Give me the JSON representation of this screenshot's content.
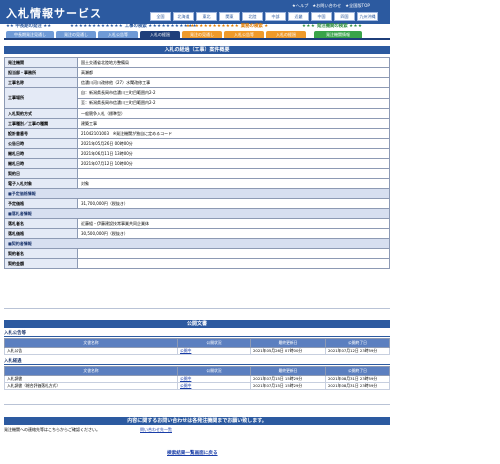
{
  "header": {
    "logo": "入札情報サービス",
    "top_links": [
      "★ヘルプ",
      "★お問い合わせ",
      "★全国版TOP"
    ],
    "regions": [
      "全国",
      "北海道",
      "東北",
      "関東",
      "北陸",
      "中部",
      "近畿",
      "中国",
      "四国",
      "九州沖縄"
    ],
    "sections": [
      {
        "stars_left": "★★★★★★★★★★★★",
        "label": "工事の検索",
        "stars_right": "★★★★★★★★★★★"
      },
      {
        "stars_left": "★★★★★★★★★★★★",
        "label": "業務の検索",
        "stars_right": "★"
      },
      {
        "stars_left": "★★★",
        "label": "発注機関の検索",
        "stars_right": "★★★"
      }
    ],
    "left_section_prefix": "★★ 中長期の発注 ★★",
    "tabs": [
      "中長期発注見通し",
      "発注の見通し",
      "入札公告等",
      "入札の経過",
      "発注の見通し",
      "入札公告等",
      "入札の経過",
      "発注機関情報"
    ]
  },
  "detail": {
    "title": "入札の経過（工事）案件概要",
    "rows": [
      {
        "k": "発注機関",
        "v": "国土交通省北陸地方整備局"
      },
      {
        "k": "担当部・事務所",
        "v": "高瀬都"
      },
      {
        "k": "工事名称",
        "v": "信濃川河川改修他（27）水閘改修工事"
      },
      {
        "k": "工事場所",
        "v": "自：新潟県長岡市信濃川三町目範囲内2-2"
      },
      {
        "k": "",
        "v": "至：新潟県長岡市信濃川三町目範囲内2-2"
      },
      {
        "k": "入札契約方式",
        "v": "一般競争入札（標準型）"
      },
      {
        "k": "工事種別／工事の種類",
        "v": "建築工事"
      },
      {
        "k": "設計書番号",
        "v": "21042101003",
        "note": "※発注機関が独自に定めるコード"
      },
      {
        "k": "公告日時",
        "v": "2021年05月26日 00時00分"
      },
      {
        "k": "開札日時",
        "v": "2021年06月11日 13時00分"
      },
      {
        "k": "開札日時",
        "v": "2021年07月12日 10時00分"
      },
      {
        "k": "契約日",
        "v": ""
      },
      {
        "k": "電子入札対象",
        "v": "対象"
      },
      {
        "full": "■予定価格情報"
      },
      {
        "k": "予定価格",
        "v": "31,700,000円（税抜き）"
      },
      {
        "full": "■落札者情報"
      },
      {
        "k": "落札者名",
        "v": "近藤組・伊藤建設技常事業共同企業体"
      },
      {
        "k": "落札価格",
        "v": "30,500,000円（税抜き）"
      },
      {
        "full": "■契約者情報"
      },
      {
        "k": "契約者名",
        "v": ""
      },
      {
        "k": "契約金額",
        "v": ""
      }
    ]
  },
  "documents": {
    "title": "公開文書",
    "groups": [
      {
        "label": "入札公告等",
        "columns": [
          "文書名称",
          "公開状況",
          "最終更新日",
          "公開終了日"
        ],
        "rows": [
          [
            "入札公告",
            "公開中",
            "2021年05月26日 07時00分",
            "2021年07月12日 23時59分"
          ]
        ]
      },
      {
        "label": "入札経過",
        "columns": [
          "文書名称",
          "公開状況",
          "最終更新日",
          "公開終了日"
        ],
        "rows": [
          [
            "入札調書",
            "公開中",
            "2021年07月15日 15時29分",
            "2021年08月31日 23時59分"
          ],
          [
            "入札調書（総合評価落札方式）",
            "公開中",
            "2021年07月15日 15時29分",
            "2021年08月31日 23時59分"
          ]
        ]
      }
    ]
  },
  "contact": {
    "title": "内容に関するお問い合わせは各発注機関までお願い致します。",
    "text": "発注機関への連絡先等はこちらからご確認ください。",
    "link": "問い合わせ先一覧"
  },
  "back_link": "検索結果一覧画面に戻る",
  "colors": {
    "primary": "#2c5aa0",
    "orange": "#ef9a2a",
    "green": "#39a449"
  }
}
